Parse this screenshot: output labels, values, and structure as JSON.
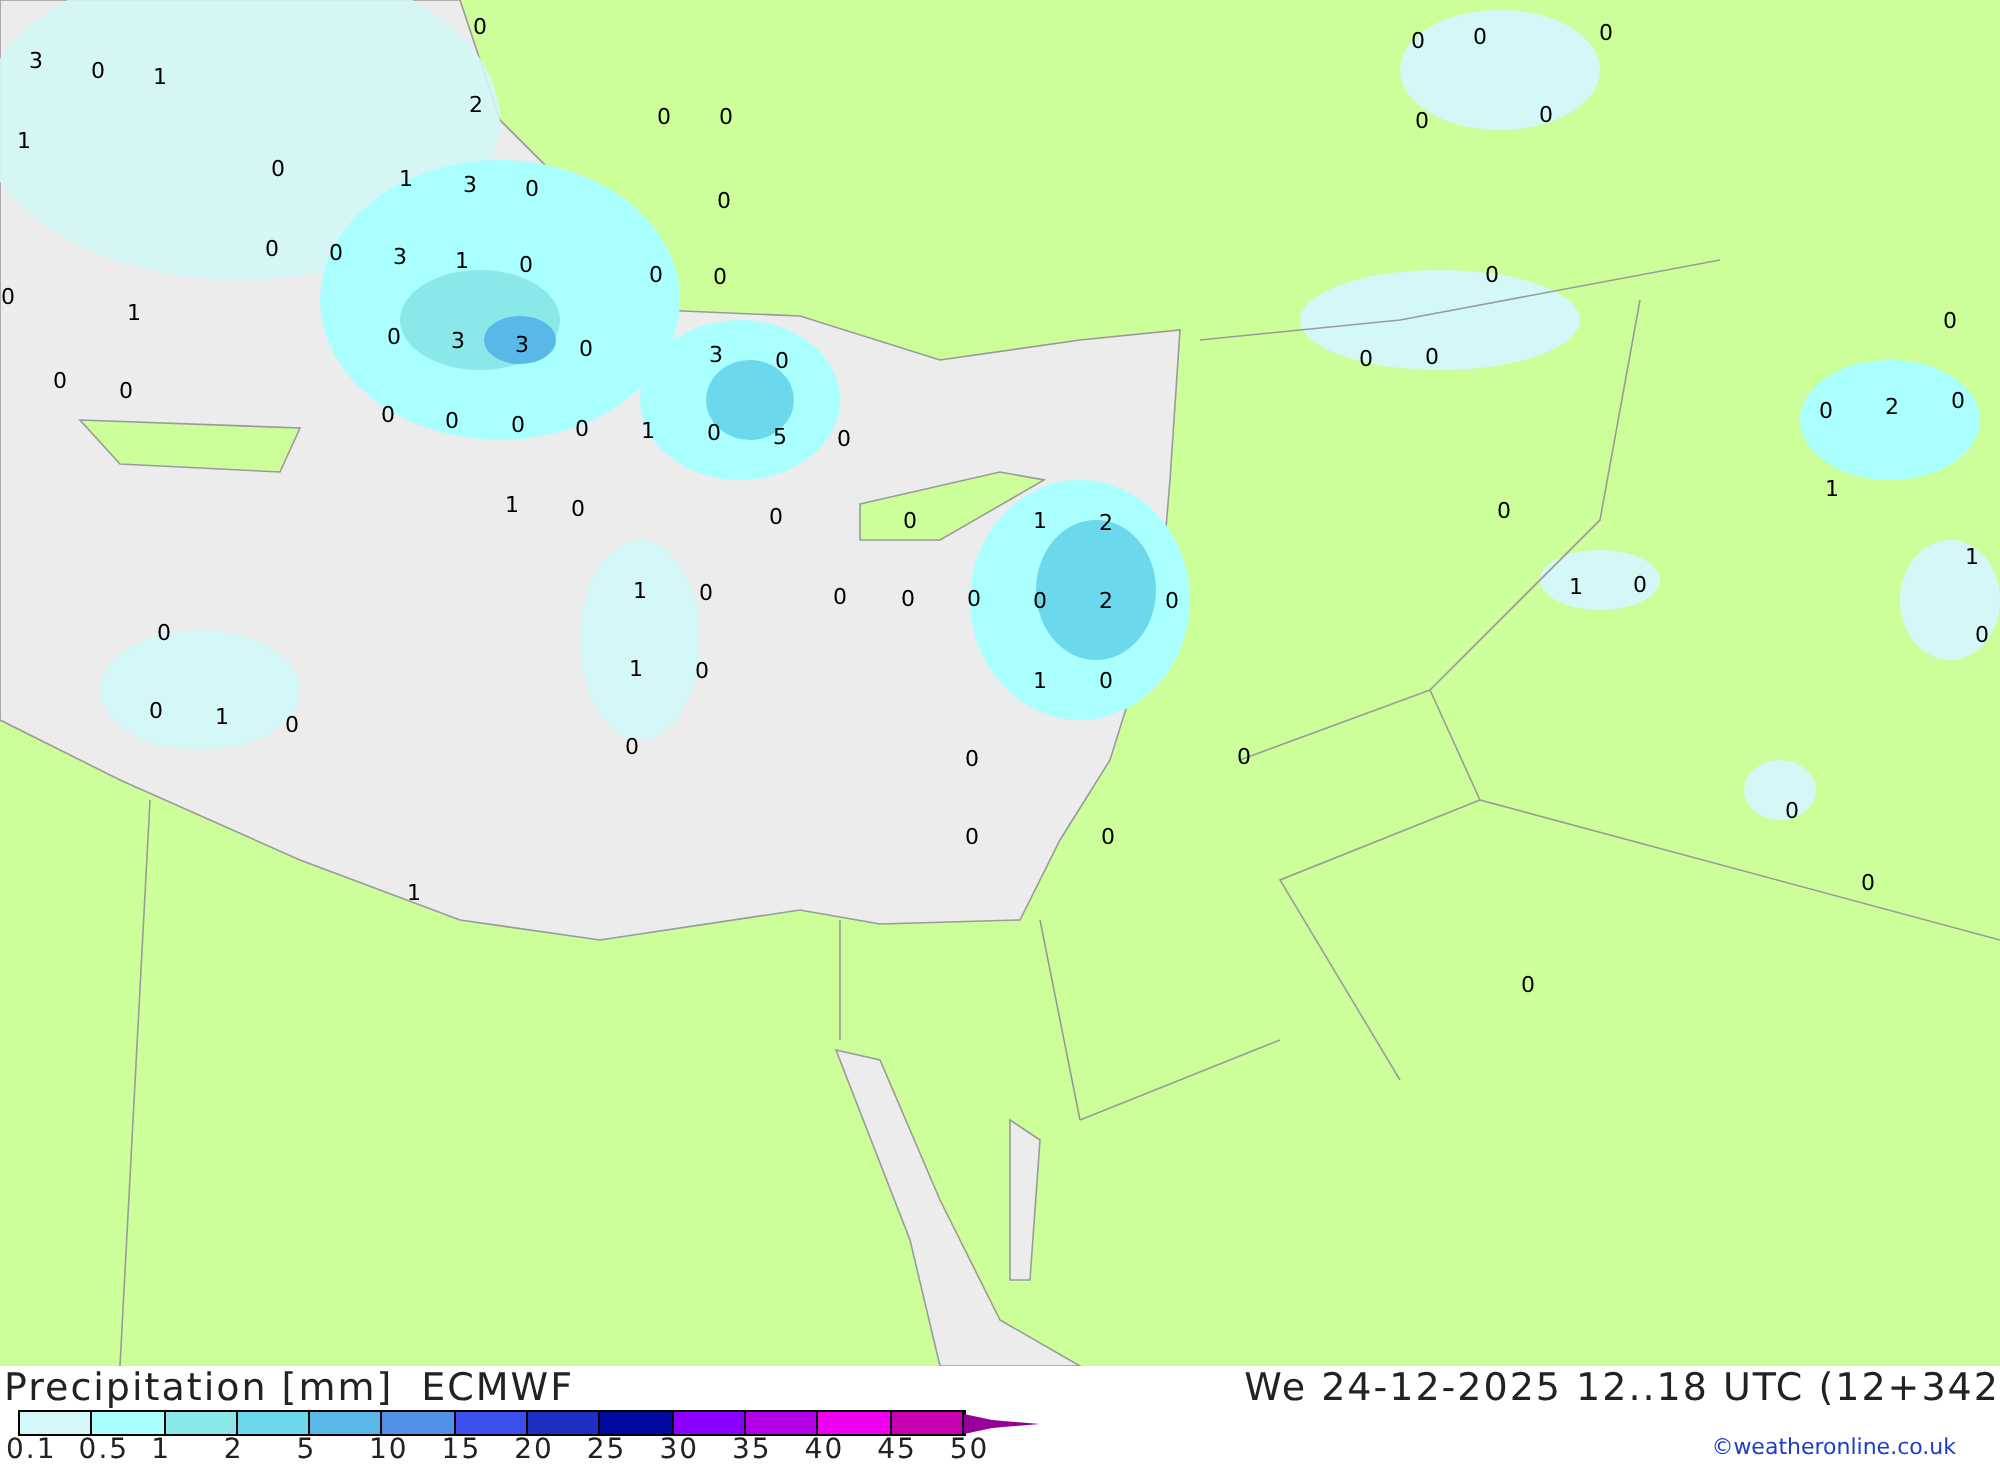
{
  "map": {
    "labels": [
      "3",
      "0",
      "1",
      "0",
      "1",
      "2",
      "0",
      "0",
      "0",
      "1",
      "3",
      "0",
      "0",
      "0",
      "0",
      "3",
      "1",
      "0",
      "0",
      "0",
      "0",
      "1",
      "0",
      "3",
      "3",
      "0",
      "3",
      "0",
      "0",
      "0",
      "0",
      "0",
      "0",
      "0",
      "1",
      "0",
      "5",
      "0",
      "1",
      "0",
      "0",
      "0",
      "1",
      "2",
      "1",
      "0",
      "0",
      "0",
      "0",
      "0",
      "2",
      "0",
      "0",
      "1",
      "0",
      "1",
      "0",
      "0",
      "1",
      "0",
      "0",
      "0",
      "0",
      "0",
      "0",
      "1",
      "0",
      "0",
      "0",
      "0",
      "0",
      "0",
      "0",
      "0",
      "0",
      "2",
      "0",
      "0",
      "1",
      "0",
      "1",
      "0",
      "1",
      "0",
      "0",
      "0",
      "0"
    ]
  },
  "legend": {
    "title": "Precipitation [mm]",
    "source": "ECMWF",
    "valid_time": "We 24-12-2025 12..18 UTC (12+342",
    "bins": [
      {
        "color": "#d4f7f7"
      },
      {
        "color": "#aaffff"
      },
      {
        "color": "#8ae8e8"
      },
      {
        "color": "#6cd8ec"
      },
      {
        "color": "#5ab8e8"
      },
      {
        "color": "#5090e8"
      },
      {
        "color": "#3c50f0"
      },
      {
        "color": "#1e2ec0"
      },
      {
        "color": "#000aa0"
      },
      {
        "color": "#8c00ff"
      },
      {
        "color": "#b400e6"
      },
      {
        "color": "#f000f0"
      },
      {
        "color": "#c800b4"
      }
    ],
    "ticks": [
      "0.1",
      "0.5",
      "1",
      "2",
      "5",
      "10",
      "15",
      "20",
      "25",
      "30",
      "35",
      "40",
      "45",
      "50"
    ],
    "credit": "©weatheronline.co.uk"
  }
}
